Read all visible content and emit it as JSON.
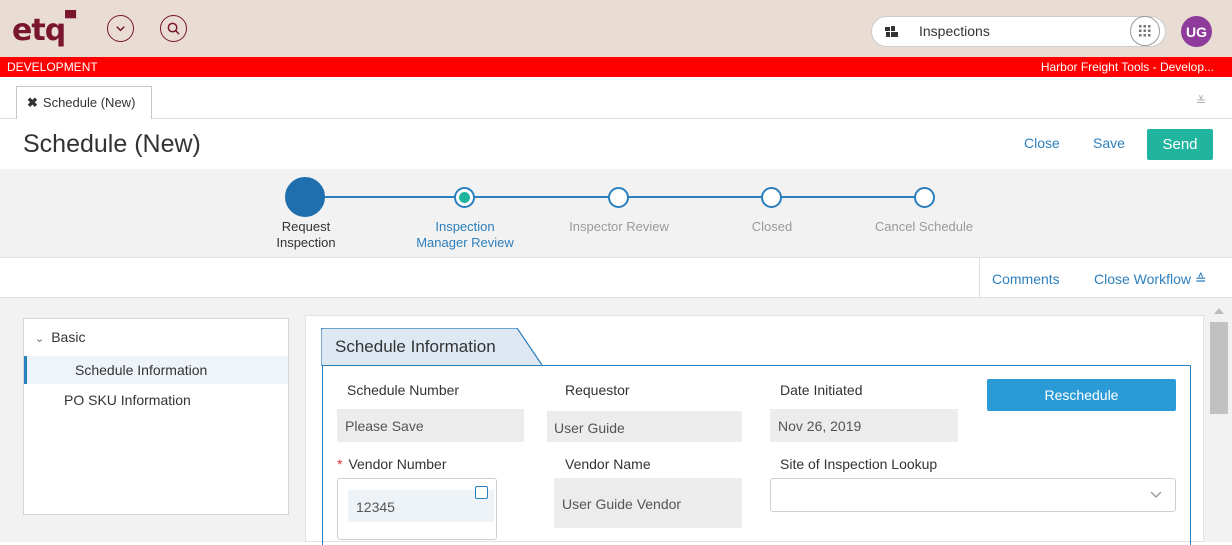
{
  "app": {
    "logo": "etq",
    "module_search": "Inspections",
    "user_initials": "UG",
    "environment": "DEVELOPMENT",
    "tenant": "Harbor Freight Tools - Develop..."
  },
  "tabs": [
    {
      "label": "Schedule (New)"
    }
  ],
  "page": {
    "title": "Schedule (New)",
    "actions": {
      "close": "Close",
      "save": "Save",
      "send": "Send"
    }
  },
  "workflow": {
    "steps": [
      {
        "label1": "Request",
        "label2": "Inspection",
        "state": "completed"
      },
      {
        "label1": "Inspection",
        "label2": "Manager Review",
        "state": "current"
      },
      {
        "label1": "Inspector Review",
        "label2": "",
        "state": "pending"
      },
      {
        "label1": "Closed",
        "label2": "",
        "state": "pending"
      },
      {
        "label1": "Cancel Schedule",
        "label2": "",
        "state": "pending"
      }
    ],
    "comments": "Comments",
    "close_workflow": "Close Workflow"
  },
  "nav": {
    "group": "Basic",
    "items": [
      "Schedule Information",
      "PO SKU Information"
    ]
  },
  "section": {
    "title": "Schedule Information",
    "reschedule": "Reschedule",
    "fields": {
      "schedule_number": {
        "label": "Schedule Number",
        "value": "Please Save"
      },
      "requestor": {
        "label": "Requestor",
        "value": "User Guide"
      },
      "date_initiated": {
        "label": "Date Initiated",
        "value": "Nov 26, 2019"
      },
      "vendor_number": {
        "label": "Vendor Number",
        "value": "12345",
        "required": "*"
      },
      "vendor_name": {
        "label": "Vendor Name",
        "value": "User Guide Vendor"
      },
      "site_lookup": {
        "label": "Site of Inspection Lookup",
        "value": ""
      }
    }
  },
  "colors": {
    "brand": "#7a1530",
    "env_band": "#ff0000",
    "accent": "#2a7fbf",
    "send": "#21b5a0",
    "avatar": "#8e3b9c"
  }
}
